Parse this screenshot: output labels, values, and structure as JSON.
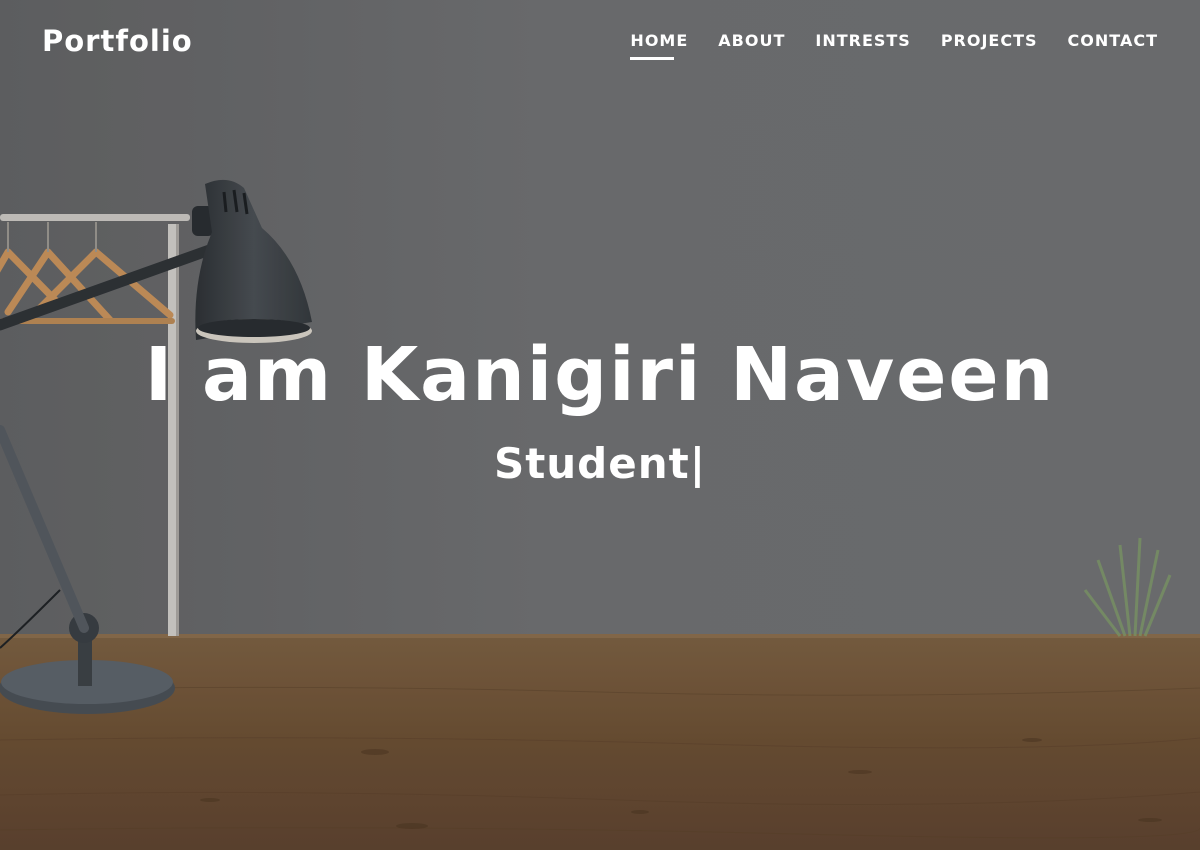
{
  "header": {
    "brand": "Portfolio"
  },
  "nav": {
    "items": [
      {
        "label": "HOME",
        "active": true
      },
      {
        "label": "ABOUT",
        "active": false
      },
      {
        "label": "INTRESTS",
        "active": false
      },
      {
        "label": "PROJECTS",
        "active": false
      },
      {
        "label": "CONTACT",
        "active": false
      }
    ]
  },
  "hero": {
    "title": "I am Kanigiri Naveen",
    "subtitle": "Student|"
  },
  "colors": {
    "text": "#ffffff",
    "wall": "#6e6e70",
    "desk": "#7a5a3a",
    "lamp": "#3c4146"
  },
  "icons": {
    "lamp": "desk-lamp-illustration",
    "rack": "clothes-rack-illustration",
    "plant": "plant-illustration"
  }
}
